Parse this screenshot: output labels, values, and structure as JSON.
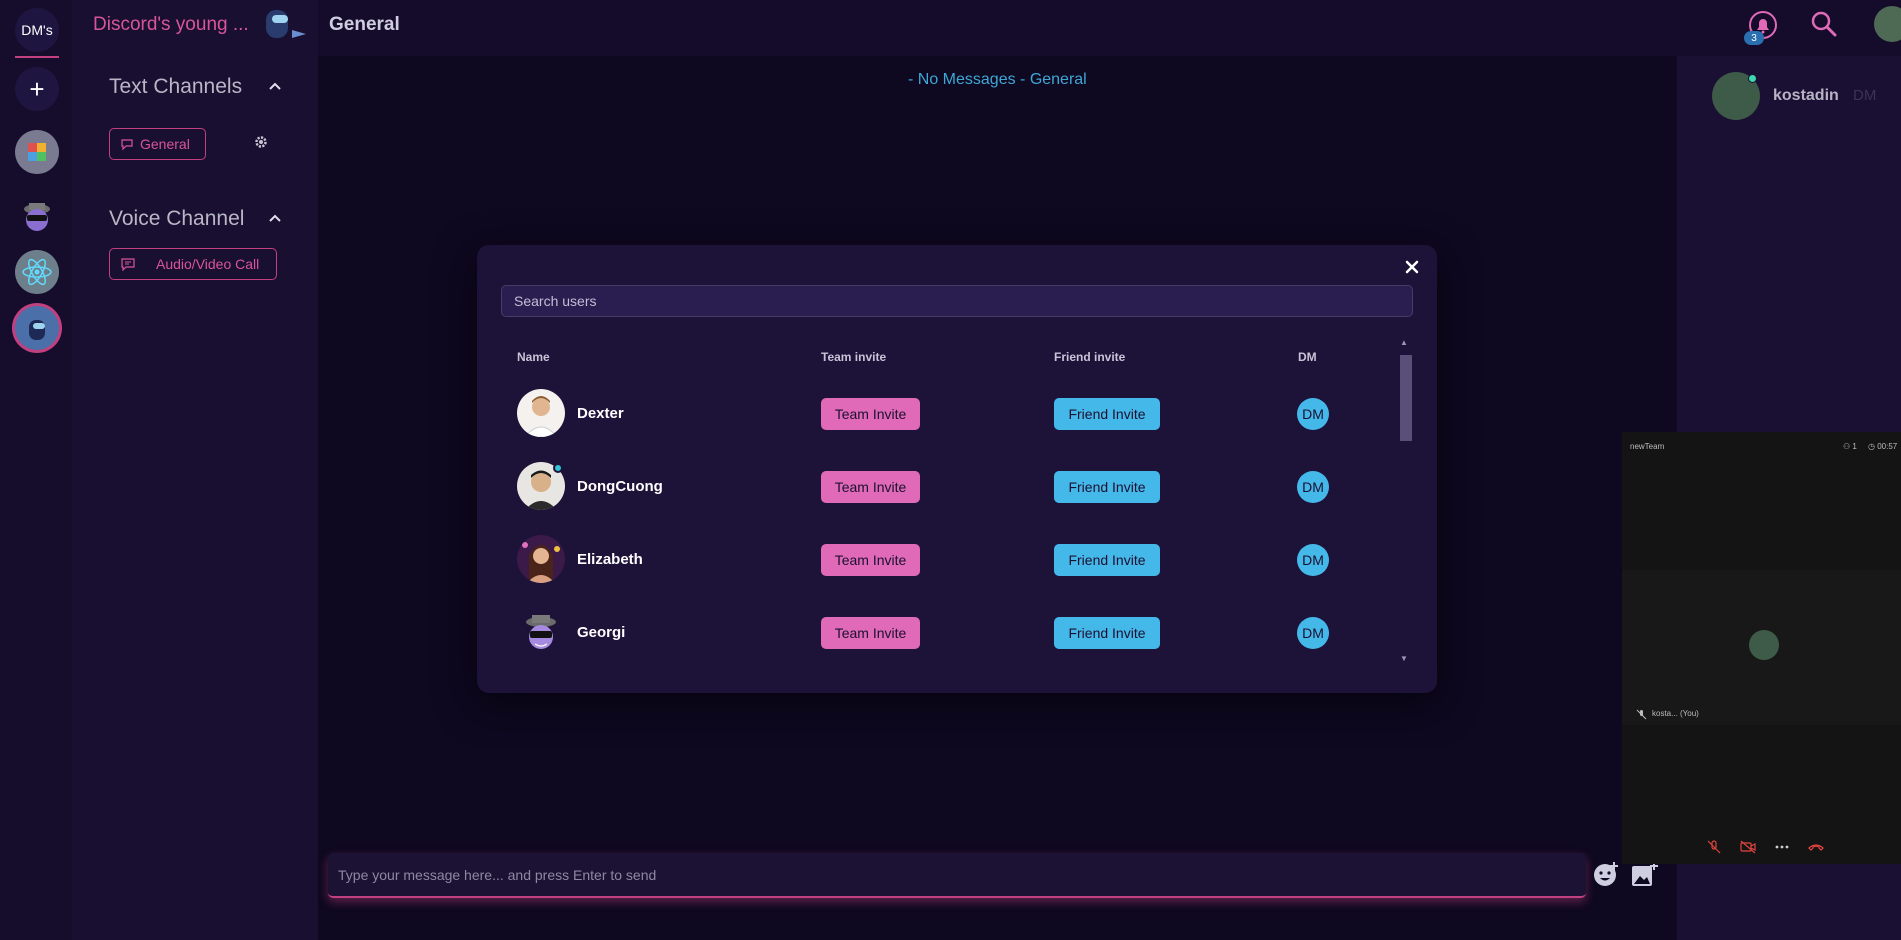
{
  "rail": {
    "dm_label": "DM's",
    "add_label": "+"
  },
  "server": {
    "name": "Discord's young ...",
    "text_channels_title": "Text Channels",
    "voice_channel_title": "Voice Channel",
    "text_channel": "General",
    "voice_channel": "Audio/Video Call"
  },
  "header": {
    "channel_title": "General",
    "notification_count": "3"
  },
  "main": {
    "empty_text": "- No Messages - General",
    "composer_placeholder": "Type your message here... and press Enter to send"
  },
  "right_panel": {
    "user_name": "kostadin",
    "dm_label": "DM"
  },
  "video": {
    "team_name": "newTeam",
    "participants": "1",
    "duration": "00:57",
    "self_label": "kosta... (You)"
  },
  "modal": {
    "search_placeholder": "Search users",
    "columns": [
      "Name",
      "Team invite",
      "Friend invite",
      "DM"
    ],
    "users": [
      {
        "name": "Dexter",
        "team_invite": "Team Invite",
        "friend_invite": "Friend Invite",
        "dm": "DM",
        "online": false
      },
      {
        "name": "DongCuong",
        "team_invite": "Team Invite",
        "friend_invite": "Friend Invite",
        "dm": "DM",
        "online": true
      },
      {
        "name": "Elizabeth",
        "team_invite": "Team Invite",
        "friend_invite": "Friend Invite",
        "dm": "DM",
        "online": false
      },
      {
        "name": "Georgi",
        "team_invite": "Team Invite",
        "friend_invite": "Friend Invite",
        "dm": "DM",
        "online": false
      }
    ]
  },
  "colors": {
    "accent_pink": "#d9559a",
    "team_button": "#e06ab8",
    "friend_button": "#45b8ea",
    "info_text": "#3fa7d6",
    "online_dot": "#35c3d6"
  }
}
